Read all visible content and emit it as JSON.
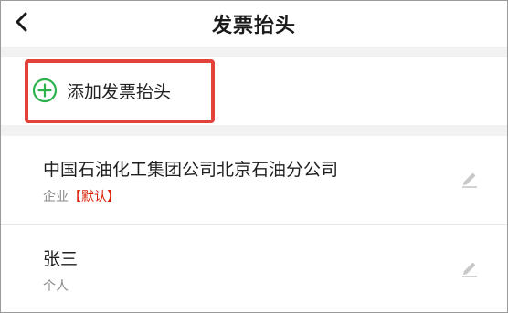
{
  "header": {
    "title": "发票抬头"
  },
  "add": {
    "label": "添加发票抬头"
  },
  "items": [
    {
      "title": "中国石油化工集团公司北京石油分公司",
      "type": "企业",
      "tag": "【默认】"
    },
    {
      "title": "张三",
      "type": "个人",
      "tag": ""
    }
  ],
  "colors": {
    "accent_green": "#2bb24c",
    "highlight_red": "#e2423a",
    "tag_red": "#d81e06"
  },
  "icons": {
    "back": "chevron-left-icon",
    "add": "plus-circle-icon",
    "edit": "pencil-icon"
  }
}
